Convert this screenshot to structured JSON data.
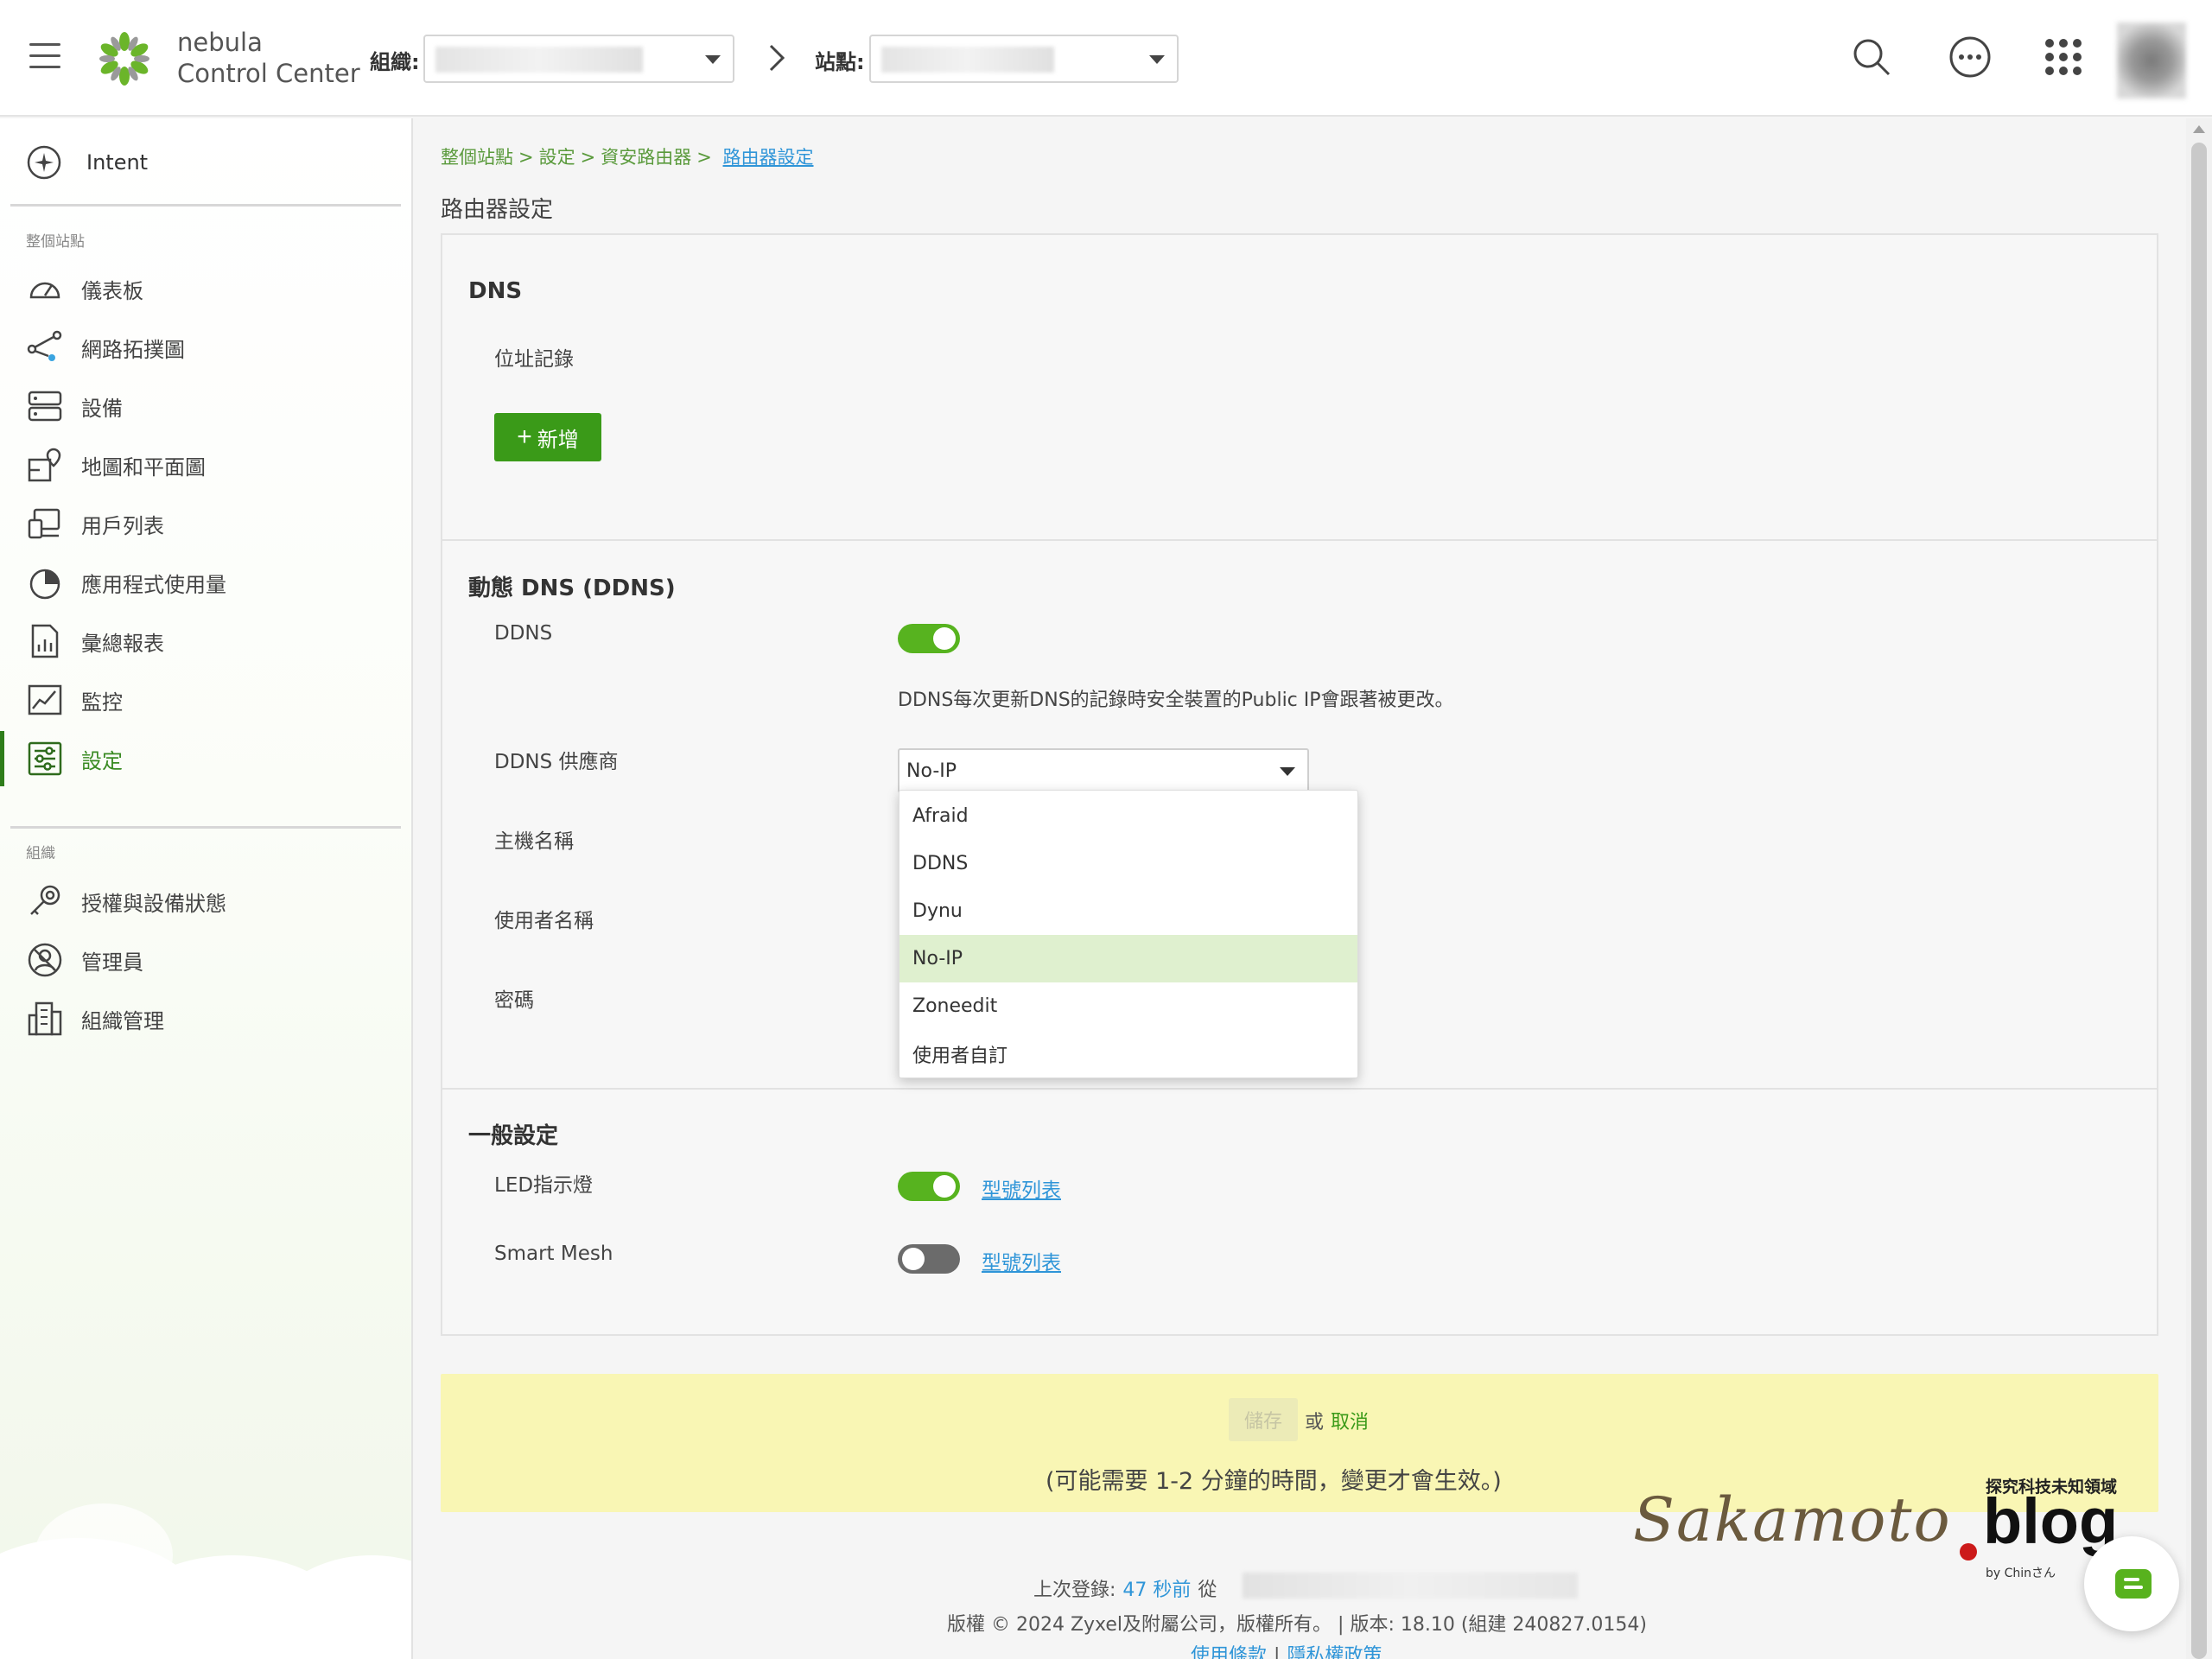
{
  "topbar": {
    "brand_line1": "nebula",
    "brand_line2": "Control Center",
    "org_label": "組織:",
    "site_label": "站點:"
  },
  "sidebar": {
    "intent_label": "Intent",
    "site_section_title": "整個站點",
    "site_items": [
      {
        "label": "儀表板",
        "icon": "dashboard-icon"
      },
      {
        "label": "網路拓撲圖",
        "icon": "topology-icon"
      },
      {
        "label": "設備",
        "icon": "devices-icon"
      },
      {
        "label": "地圖和平面圖",
        "icon": "map-icon"
      },
      {
        "label": "用戶列表",
        "icon": "clients-icon"
      },
      {
        "label": "應用程式使用量",
        "icon": "app-usage-icon"
      },
      {
        "label": "彙總報表",
        "icon": "report-icon"
      },
      {
        "label": "監控",
        "icon": "monitor-icon"
      },
      {
        "label": "設定",
        "icon": "settings-icon",
        "active": true
      }
    ],
    "org_section_title": "組織",
    "org_items": [
      {
        "label": "授權與設備狀態",
        "icon": "license-icon"
      },
      {
        "label": "管理員",
        "icon": "admin-icon"
      },
      {
        "label": "組織管理",
        "icon": "org-manage-icon"
      }
    ]
  },
  "breadcrumb": {
    "items": [
      "整個站點",
      "設定",
      "資安路由器"
    ],
    "current": "路由器設定"
  },
  "page_title": "路由器設定",
  "dns": {
    "heading": "DNS",
    "address_record_label": "位址記錄",
    "add_button": "新增"
  },
  "ddns": {
    "heading": "動態 DNS (DDNS)",
    "ddns_label": "DDNS",
    "ddns_enabled": true,
    "note": "DDNS每次更新DNS的記錄時安全裝置的Public IP會跟著被更改。",
    "provider_label": "DDNS 供應商",
    "provider_value": "No-IP",
    "hostname_label": "主機名稱",
    "username_label": "使用者名稱",
    "password_label": "密碼",
    "provider_options": [
      "Afraid",
      "DDNS",
      "Dynu",
      "No-IP",
      "Zoneedit",
      "使用者自訂"
    ],
    "selected_index": 3
  },
  "general": {
    "heading": "一般設定",
    "led_label": "LED指示燈",
    "led_enabled": true,
    "led_link": "型號列表",
    "mesh_label": "Smart Mesh",
    "mesh_enabled": false,
    "mesh_link": "型號列表"
  },
  "actions": {
    "save": "儲存",
    "or": "或",
    "cancel": "取消",
    "note": "(可能需要 1-2 分鐘的時間，變更才會生效。)"
  },
  "footer": {
    "last_login_label": "上次登錄:",
    "last_login_ago": "47 秒前",
    "from_label": "從",
    "copyright": "版權 © 2024 Zyxel及附屬公司，版權所有。 | 版本: 18.10 (組建 240827.0154)",
    "terms": "使用條款",
    "separator": "|",
    "privacy": "隱私權政策"
  },
  "watermark": {
    "tagline": "探究科技未知領域",
    "name": "Sakamoto",
    "blog": "blog",
    "by": "by Chinさん"
  },
  "colors": {
    "accent_green": "#3a9a18",
    "toggle_on": "#57b31f",
    "link_blue": "#2f95d8",
    "save_bar": "#f9f6b4",
    "selected_option": "#dff0cf"
  }
}
